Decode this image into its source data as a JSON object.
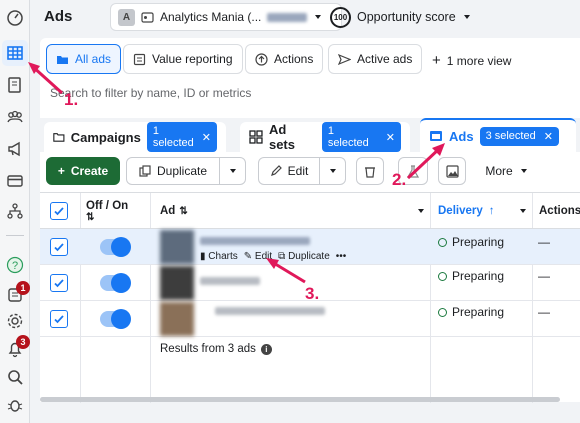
{
  "header": {
    "title": "Ads",
    "account_letter": "A",
    "account_name": "Analytics Mania (...",
    "opportunity_score": "100",
    "opportunity_label": "Opportunity score"
  },
  "views": {
    "items": [
      {
        "label": "All ads"
      },
      {
        "label": "Value reporting"
      },
      {
        "label": "Actions"
      },
      {
        "label": "Active ads"
      }
    ],
    "more": "1 more view",
    "filter_placeholder": "Search to filter by name, ID or metrics"
  },
  "levels": {
    "campaigns": {
      "label": "Campaigns",
      "selected": "1 selected"
    },
    "adsets": {
      "label": "Ad sets",
      "selected": "1 selected"
    },
    "ads": {
      "label": "Ads",
      "selected": "3 selected"
    }
  },
  "toolbar": {
    "create": "Create",
    "duplicate": "Duplicate",
    "edit": "Edit",
    "more": "More"
  },
  "table": {
    "headers": {
      "offon": "Off / On",
      "ad": "Ad",
      "delivery": "Delivery",
      "actions": "Actions"
    },
    "rows": [
      {
        "delivery": "Preparing",
        "actions": "—"
      },
      {
        "delivery": "Preparing",
        "actions": "—"
      },
      {
        "delivery": "Preparing",
        "actions": "—"
      }
    ],
    "hover_actions": {
      "charts": "Charts",
      "edit": "Edit",
      "duplicate": "Duplicate"
    },
    "results": "Results from 3 ads"
  },
  "nav_badges": {
    "first": "1",
    "second": "3"
  },
  "annotations": {
    "a1": "1.",
    "a2": "2.",
    "a3": "3."
  },
  "colors": {
    "accent": "#1877f2",
    "create": "#1d6b35",
    "annotation": "#e0185a"
  }
}
